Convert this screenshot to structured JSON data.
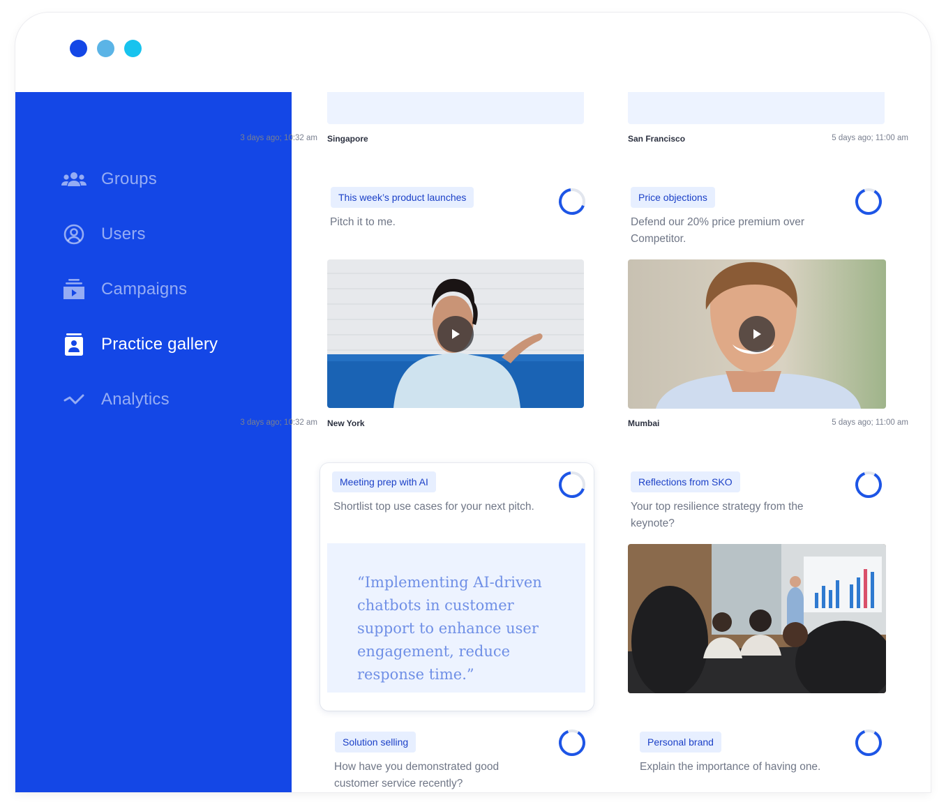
{
  "window": {
    "dot_colors": [
      "#1447e6",
      "#5bb4e6",
      "#18c3ee"
    ]
  },
  "sidebar": {
    "items": [
      {
        "label": "Groups",
        "icon": "groups-icon",
        "active": false
      },
      {
        "label": "Users",
        "icon": "user-circle-icon",
        "active": false
      },
      {
        "label": "Campaigns",
        "icon": "campaigns-icon",
        "active": false
      },
      {
        "label": "Practice gallery",
        "icon": "practice-gallery-icon",
        "active": true
      },
      {
        "label": "Analytics",
        "icon": "analytics-icon",
        "active": false
      }
    ]
  },
  "gallery": {
    "top_row": [
      {
        "location": "Singapore",
        "timestamp": "3 days ago; 10:32 am"
      },
      {
        "location": "San Francisco",
        "timestamp": "5 days ago; 11:00 am"
      }
    ],
    "cards": [
      {
        "tag": "This week’s product launches",
        "prompt": "Pitch it to me.",
        "media": "video-woman-speaking",
        "location": "New York",
        "timestamp": "3 days ago; 10:32 am"
      },
      {
        "tag": "Price objections",
        "prompt": "Defend our 20% price premium over Competitor.",
        "media": "video-man-smiling",
        "location": "Mumbai",
        "timestamp": "5 days ago; 11:00 am"
      },
      {
        "tag": "Meeting prep with AI",
        "prompt": "Shortlist top use cases for your next pitch.",
        "quote": "“Implementing AI-driven chatbots in customer support to enhance user engagement, reduce response time.”"
      },
      {
        "tag": "Reflections from SKO",
        "prompt": "Your top resilience strategy from the keynote?",
        "media": "photo-meeting-presentation"
      },
      {
        "tag": "Solution selling",
        "prompt": "How have you demonstrated good customer service recently?"
      },
      {
        "tag": "Personal brand",
        "prompt": "Explain the importance of having one."
      }
    ]
  },
  "colors": {
    "brand": "#1447e6",
    "chip_bg": "#e7efff",
    "chip_text": "#1b40c7"
  }
}
